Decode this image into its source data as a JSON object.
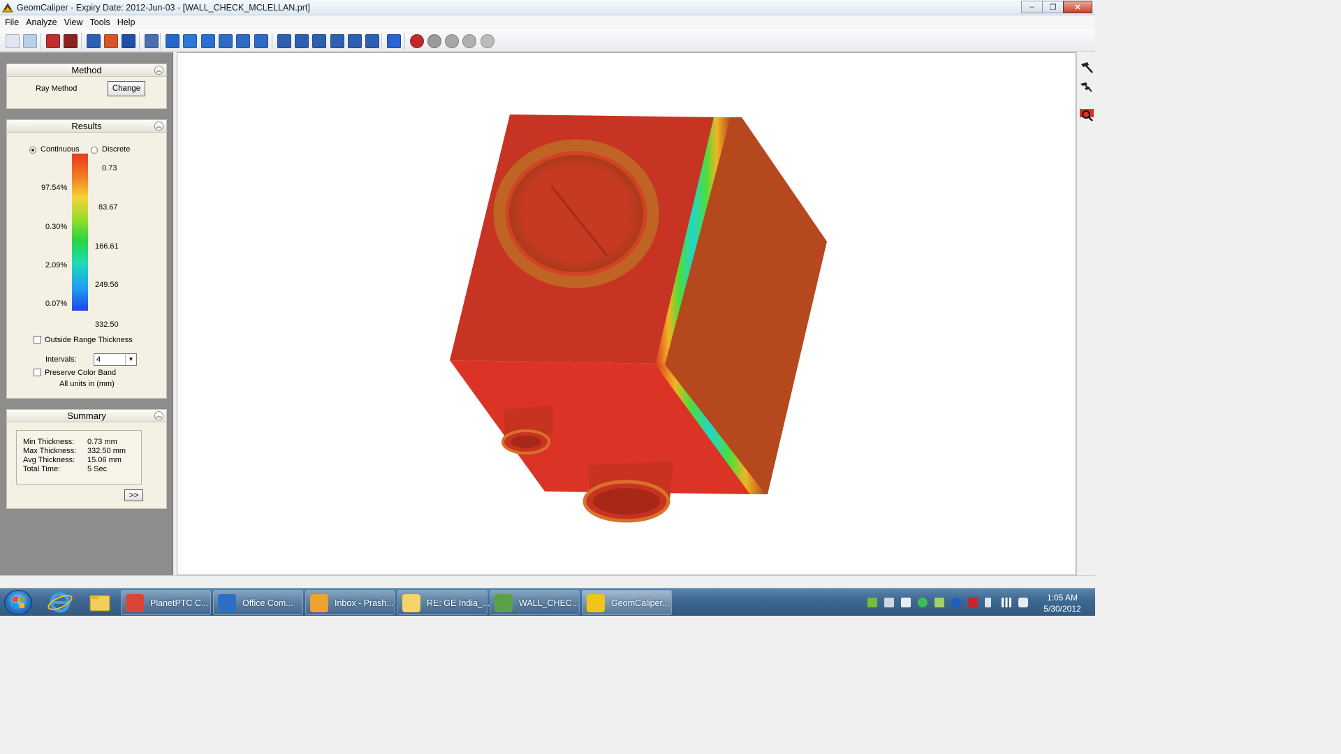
{
  "window": {
    "title": "GeomCaliper -  Expiry Date: 2012-Jun-03  - [WALL_CHECK_MCLELLAN.prt]",
    "minimize": "‒",
    "restore": "❐",
    "close": "✕"
  },
  "menu": [
    "File",
    "Analyze",
    "View",
    "Tools",
    "Help"
  ],
  "toolbar_icons": [
    "new-document-icon",
    "print-icon",
    "compute-icon",
    "report-icon",
    "section-icon",
    "hatch-icon",
    "thickness-icon",
    "model-icon",
    "select-arrow-icon",
    "rotate-icon",
    "pan-icon",
    "zoom-fit-icon",
    "zoom-window-icon",
    "zoom-icon",
    "view-front-icon",
    "view-back-icon",
    "view-top-icon",
    "view-bottom-icon",
    "view-left-icon",
    "view-right-icon",
    "view-iso-icon",
    "render-shaded-icon",
    "render-wire-icon",
    "render-hidden-icon",
    "render-edges-icon",
    "render-transparent-icon"
  ],
  "method_panel": {
    "title": "Method",
    "method_name": "Ray Method",
    "change_button": "Change"
  },
  "results_panel": {
    "title": "Results",
    "mode_continuous": "Continuous",
    "mode_discrete": "Discrete",
    "selected_mode": "Continuous",
    "legend_values": [
      "0.73",
      "83.67",
      "166.61",
      "249.56",
      "332.50"
    ],
    "legend_percents": [
      "97.54%",
      "0.30%",
      "2.09%",
      "0.07%"
    ],
    "outside_range_label": "Outside Range Thickness",
    "outside_range_checked": false,
    "intervals_label": "Intervals:",
    "intervals_value": "4",
    "preserve_band_label": "Preserve Color Band",
    "preserve_band_checked": false,
    "units_note": "All units in (mm)"
  },
  "summary_panel": {
    "title": "Summary",
    "rows": [
      {
        "label": "Min Thickness:",
        "value": "0.73 mm"
      },
      {
        "label": "Max Thickness:",
        "value": "332.50 mm"
      },
      {
        "label": "Avg Thickness:",
        "value": "15.06 mm"
      },
      {
        "label": "Total Time:",
        "value": "5 Sec"
      }
    ],
    "more_button": ">>"
  },
  "right_tools": [
    "hammer-icon",
    "double-hammer-icon",
    "inspect-icon"
  ],
  "taskbar": {
    "pinned": [
      "internet-explorer-icon",
      "file-explorer-icon"
    ],
    "tasks": [
      {
        "label": "PlanetPTC C...",
        "icon": "chrome-icon"
      },
      {
        "label": "Office Com...",
        "icon": "office-communicator-icon"
      },
      {
        "label": "Inbox - Prash...",
        "icon": "outlook-icon"
      },
      {
        "label": "RE: GE India_...",
        "icon": "mail-icon"
      },
      {
        "label": "WALL_CHEC...",
        "icon": "window-icon"
      },
      {
        "label": "GeomCaliper...",
        "icon": "geomcaliper-icon",
        "active": true
      }
    ],
    "clock_time": "1:05 AM",
    "clock_date": "5/30/2012"
  },
  "colors": {
    "heat_red": "#d9342a",
    "heat_orange": "#b54a1e",
    "panel_bg": "#f4f0e3",
    "taskbar": "#3f6a93"
  }
}
